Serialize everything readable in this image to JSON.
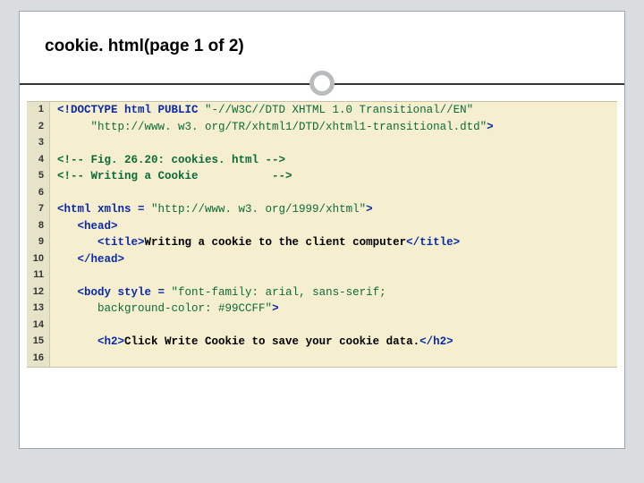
{
  "slide": {
    "title": "cookie. html(page 1 of 2)"
  },
  "code": {
    "lines": [
      {
        "n": "1",
        "segs": [
          {
            "cls": "kw",
            "t": "<!DOCTYPE html PUBLIC"
          },
          {
            "cls": "str",
            "t": " \"-//W3C//DTD XHTML 1.0 Transitional//EN\""
          }
        ]
      },
      {
        "n": "2",
        "segs": [
          {
            "cls": "",
            "t": "     "
          },
          {
            "cls": "str",
            "t": "\"http://www. w3. org/TR/xhtml1/DTD/xhtml1-transitional.dtd\""
          },
          {
            "cls": "kw",
            "t": ">"
          }
        ]
      },
      {
        "n": "3",
        "segs": [
          {
            "cls": "",
            "t": " "
          }
        ]
      },
      {
        "n": "4",
        "segs": [
          {
            "cls": "cmt",
            "t": "<!-- Fig. 26.20: cookies. html -->"
          }
        ]
      },
      {
        "n": "5",
        "segs": [
          {
            "cls": "cmt",
            "t": "<!-- Writing a Cookie           -->"
          }
        ]
      },
      {
        "n": "6",
        "segs": [
          {
            "cls": "",
            "t": " "
          }
        ]
      },
      {
        "n": "7",
        "segs": [
          {
            "cls": "kw",
            "t": "<html xmlns = "
          },
          {
            "cls": "str",
            "t": "\"http://www. w3. org/1999/xhtml\""
          },
          {
            "cls": "kw",
            "t": ">"
          }
        ]
      },
      {
        "n": "8",
        "segs": [
          {
            "cls": "",
            "t": "   "
          },
          {
            "cls": "kw",
            "t": "<head>"
          }
        ]
      },
      {
        "n": "9",
        "segs": [
          {
            "cls": "",
            "t": "      "
          },
          {
            "cls": "kw",
            "t": "<title>"
          },
          {
            "cls": "pl",
            "t": "Writing a cookie to the client computer"
          },
          {
            "cls": "kw",
            "t": "</title>"
          }
        ]
      },
      {
        "n": "10",
        "segs": [
          {
            "cls": "",
            "t": "   "
          },
          {
            "cls": "kw",
            "t": "</head>"
          }
        ]
      },
      {
        "n": "11",
        "segs": [
          {
            "cls": "",
            "t": " "
          }
        ]
      },
      {
        "n": "12",
        "segs": [
          {
            "cls": "",
            "t": "   "
          },
          {
            "cls": "kw",
            "t": "<body style = "
          },
          {
            "cls": "str",
            "t": "\"font-family: arial, sans-serif;"
          }
        ]
      },
      {
        "n": "13",
        "segs": [
          {
            "cls": "",
            "t": "      "
          },
          {
            "cls": "str",
            "t": "background-color: #99CCFF\""
          },
          {
            "cls": "kw",
            "t": ">"
          }
        ]
      },
      {
        "n": "14",
        "segs": [
          {
            "cls": "",
            "t": " "
          }
        ]
      },
      {
        "n": "15",
        "segs": [
          {
            "cls": "",
            "t": "      "
          },
          {
            "cls": "kw",
            "t": "<h2>"
          },
          {
            "cls": "pl",
            "t": "Click Write Cookie to save your cookie data."
          },
          {
            "cls": "kw",
            "t": "</h2>"
          }
        ]
      },
      {
        "n": "16",
        "segs": [
          {
            "cls": "",
            "t": " "
          }
        ]
      }
    ]
  }
}
